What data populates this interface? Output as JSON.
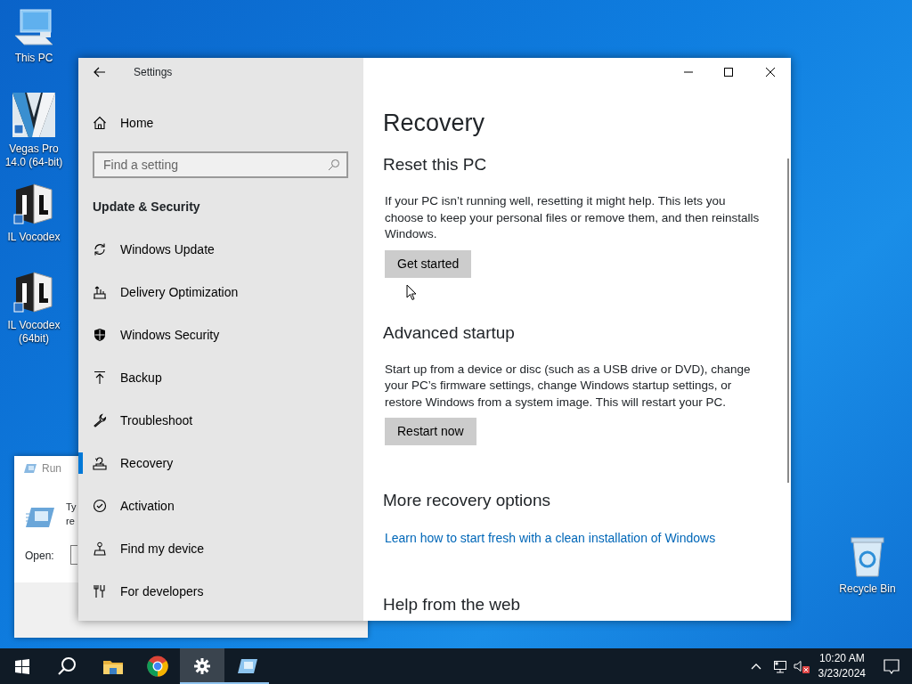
{
  "desktop_icons": [
    {
      "kind": "computer",
      "label": "This PC"
    },
    {
      "kind": "vegas",
      "label": "Vegas Pro 14.0 (64-bit)"
    },
    {
      "kind": "vocodex",
      "label": "IL Vocodex"
    },
    {
      "kind": "vocodex",
      "label": "IL Vocodex (64bit)"
    },
    {
      "kind": "recycle-bin",
      "label": "Recycle Bin"
    }
  ],
  "run_dialog": {
    "title": "Run",
    "description_lines": [
      "Ty",
      "re"
    ],
    "open_label": "Open:"
  },
  "settings_window": {
    "title": "Settings",
    "home": "Home",
    "search": {
      "placeholder": "Find a setting"
    },
    "category": "Update & Security",
    "nav": [
      {
        "kind": "refresh",
        "label": "Windows Update",
        "selected": false
      },
      {
        "kind": "delivery",
        "label": "Delivery Optimization",
        "selected": false
      },
      {
        "kind": "shield",
        "label": "Windows Security",
        "selected": false
      },
      {
        "kind": "backup",
        "label": "Backup",
        "selected": false
      },
      {
        "kind": "wrench",
        "label": "Troubleshoot",
        "selected": false
      },
      {
        "kind": "recovery",
        "label": "Recovery",
        "selected": true
      },
      {
        "kind": "check",
        "label": "Activation",
        "selected": false
      },
      {
        "kind": "person",
        "label": "Find my device",
        "selected": false
      },
      {
        "kind": "tools",
        "label": "For developers",
        "selected": false
      }
    ],
    "page_title": "Recovery",
    "sections": [
      {
        "heading": "Reset this PC",
        "text": "If your PC isn’t running well, resetting it might help. This lets you choose to keep your personal files or remove them, and then reinstalls Windows.",
        "button": "Get started"
      },
      {
        "heading": "Advanced startup",
        "text": "Start up from a device or disc (such as a USB drive or DVD), change your PC’s firmware settings, change Windows startup settings, or restore Windows from a system image. This will restart your PC.",
        "button": "Restart now"
      },
      {
        "heading": "More recovery options",
        "link": "Learn how to start fresh with a clean installation of Windows"
      },
      {
        "heading": "Help from the web"
      }
    ]
  },
  "taskbar": {
    "apps": [
      {
        "kind": "start",
        "selected": false,
        "running": false
      },
      {
        "kind": "search",
        "selected": false,
        "running": false
      },
      {
        "kind": "explorer",
        "selected": false,
        "running": false
      },
      {
        "kind": "chrome",
        "selected": false,
        "running": false
      },
      {
        "kind": "settings",
        "selected": true,
        "running": true
      },
      {
        "kind": "run",
        "selected": false,
        "running": true
      }
    ],
    "clock": {
      "time": "10:20 AM",
      "date": "3/23/2024"
    }
  }
}
